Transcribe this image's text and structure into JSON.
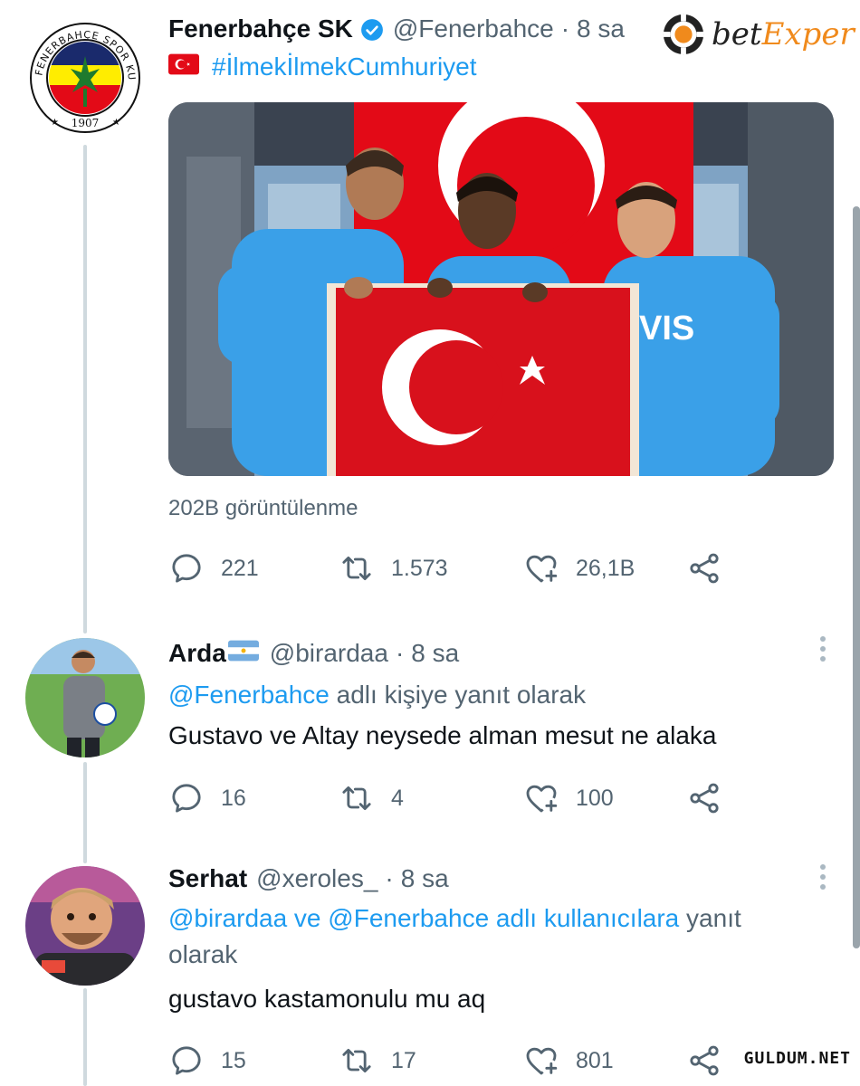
{
  "main_tweet": {
    "name": "Fenerbahçe SK",
    "handle": "@Fenerbahce",
    "separator": "·",
    "time": "8 sa",
    "hashtag": "#İlmekİlmekCumhuriyet",
    "views": "202B görüntülenme",
    "replies": "221",
    "retweets": "1.573",
    "likes": "26,1B",
    "jersey_text": "VIS",
    "logo_text": "FENERBAHÇE SPOR KULÜBÜ",
    "logo_year": "1907"
  },
  "replies": [
    {
      "name": "Arda",
      "handle": "@birardaa",
      "separator": "·",
      "time": "8 sa",
      "reply_link": "@Fenerbahce",
      "reply_suffix": " adlı kişiye yanıt olarak",
      "text": "Gustavo ve Altay neysede alman mesut ne alaka",
      "replies": "16",
      "retweets": "4",
      "likes": "100"
    },
    {
      "name": "Serhat",
      "handle": "@xeroles_",
      "separator": "·",
      "time": "8 sa",
      "reply_link": "@birardaa ve @Fenerbahce adlı kullanıcılara",
      "reply_suffix": " yanıt olarak",
      "text": "gustavo kastamonulu mu aq",
      "replies": "15",
      "retweets": "17",
      "likes": "801"
    }
  ],
  "brand": {
    "name_part1": "bet",
    "name_part2": "Exper"
  },
  "watermark": "GULDUM.NET",
  "colors": {
    "accent": "#1d9bf0",
    "muted": "#536471",
    "flag_red": "#e30a17",
    "fb_yellow": "#ffed00",
    "fb_navy": "#1a2a6c",
    "jersey_blue": "#3aa0e8"
  }
}
